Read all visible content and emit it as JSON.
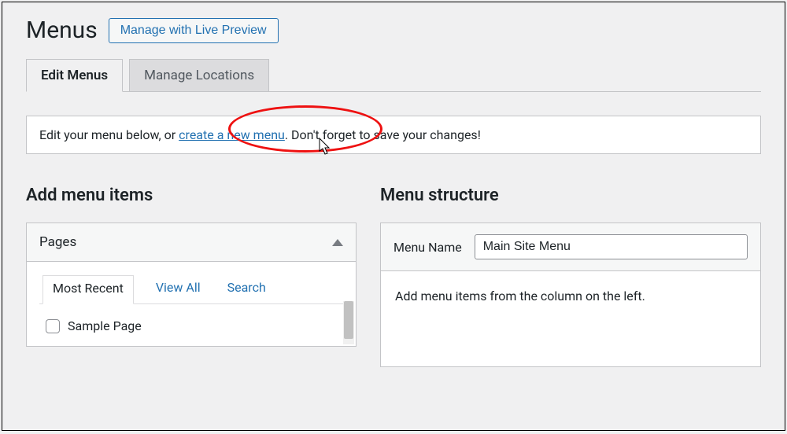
{
  "header": {
    "title": "Menus",
    "live_preview_label": "Manage with Live Preview"
  },
  "tabs": {
    "edit": "Edit Menus",
    "locations": "Manage Locations"
  },
  "notice": {
    "prefix": "Edit your menu below, or ",
    "link": "create a new menu",
    "suffix": ". Don't forget to save your changes!"
  },
  "left": {
    "section_title": "Add menu items",
    "pages": {
      "title": "Pages",
      "tabs": {
        "recent": "Most Recent",
        "view_all": "View All",
        "search": "Search"
      },
      "items": [
        {
          "label": "Sample Page"
        }
      ]
    }
  },
  "right": {
    "section_title": "Menu structure",
    "menu_name_label": "Menu Name",
    "menu_name_value": "Main Site Menu",
    "hint": "Add menu items from the column on the left."
  }
}
